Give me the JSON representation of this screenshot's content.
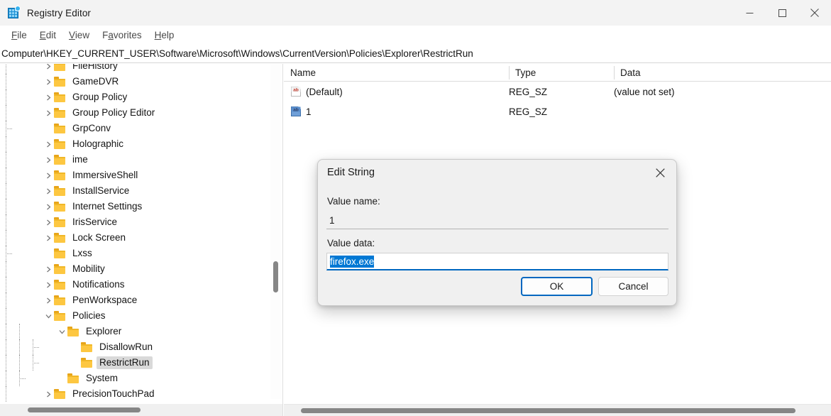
{
  "window": {
    "title": "Registry Editor",
    "icon": "registry-editor-icon",
    "controls": {
      "minimize": "minimize-icon",
      "maximize": "maximize-icon",
      "close": "close-icon"
    }
  },
  "menubar": {
    "items": [
      {
        "label": "File",
        "accel": "F"
      },
      {
        "label": "Edit",
        "accel": "E"
      },
      {
        "label": "View",
        "accel": "V"
      },
      {
        "label": "Favorites",
        "accel": "a"
      },
      {
        "label": "Help",
        "accel": "H"
      }
    ]
  },
  "address": {
    "path": "Computer\\HKEY_CURRENT_USER\\Software\\Microsoft\\Windows\\CurrentVersion\\Policies\\Explorer\\RestrictRun"
  },
  "tree": {
    "items": [
      {
        "label": "FileHistory",
        "indent": 1,
        "expander": "collapsed",
        "selected": false
      },
      {
        "label": "GameDVR",
        "indent": 1,
        "expander": "collapsed",
        "selected": false
      },
      {
        "label": "Group Policy",
        "indent": 1,
        "expander": "collapsed",
        "selected": false
      },
      {
        "label": "Group Policy Editor",
        "indent": 1,
        "expander": "collapsed",
        "selected": false
      },
      {
        "label": "GrpConv",
        "indent": 1,
        "expander": "none",
        "selected": false
      },
      {
        "label": "Holographic",
        "indent": 1,
        "expander": "collapsed",
        "selected": false
      },
      {
        "label": "ime",
        "indent": 1,
        "expander": "collapsed",
        "selected": false
      },
      {
        "label": "ImmersiveShell",
        "indent": 1,
        "expander": "collapsed",
        "selected": false
      },
      {
        "label": "InstallService",
        "indent": 1,
        "expander": "collapsed",
        "selected": false
      },
      {
        "label": "Internet Settings",
        "indent": 1,
        "expander": "collapsed",
        "selected": false
      },
      {
        "label": "IrisService",
        "indent": 1,
        "expander": "collapsed",
        "selected": false
      },
      {
        "label": "Lock Screen",
        "indent": 1,
        "expander": "collapsed",
        "selected": false
      },
      {
        "label": "Lxss",
        "indent": 1,
        "expander": "none",
        "selected": false
      },
      {
        "label": "Mobility",
        "indent": 1,
        "expander": "collapsed",
        "selected": false
      },
      {
        "label": "Notifications",
        "indent": 1,
        "expander": "collapsed",
        "selected": false
      },
      {
        "label": "PenWorkspace",
        "indent": 1,
        "expander": "collapsed",
        "selected": false
      },
      {
        "label": "Policies",
        "indent": 1,
        "expander": "expanded",
        "selected": false
      },
      {
        "label": "Explorer",
        "indent": 2,
        "expander": "expanded",
        "selected": false
      },
      {
        "label": "DisallowRun",
        "indent": 3,
        "expander": "none",
        "selected": false
      },
      {
        "label": "RestrictRun",
        "indent": 3,
        "expander": "none",
        "selected": true
      },
      {
        "label": "System",
        "indent": 2,
        "expander": "none",
        "selected": false
      },
      {
        "label": "PrecisionTouchPad",
        "indent": 1,
        "expander": "collapsed",
        "selected": false
      }
    ]
  },
  "values": {
    "columns": [
      {
        "key": "name",
        "label": "Name"
      },
      {
        "key": "type",
        "label": "Type"
      },
      {
        "key": "data",
        "label": "Data"
      }
    ],
    "rows": [
      {
        "icon": "string-value-icon",
        "name": "(Default)",
        "type": "REG_SZ",
        "data": "(value not set)",
        "selected": false
      },
      {
        "icon": "string-value-icon-selected",
        "name": "1",
        "type": "REG_SZ",
        "data": "",
        "selected": true
      }
    ]
  },
  "dialog": {
    "title": "Edit String",
    "close_icon": "close-icon",
    "value_name_label": "Value name:",
    "value_name": "1",
    "value_data_label": "Value data:",
    "value_data": "firefox.exe",
    "value_data_selected": true,
    "ok_label": "OK",
    "cancel_label": "Cancel"
  },
  "colors": {
    "accent": "#0067c0",
    "selection": "#0078d4",
    "folder": "#fdc741",
    "tree_selected_bg": "#d9d9d9",
    "titlebar_bg": "#f3f3f3",
    "dialog_bg": "#f0f0f0",
    "scrollbar_thumb": "#868686"
  }
}
